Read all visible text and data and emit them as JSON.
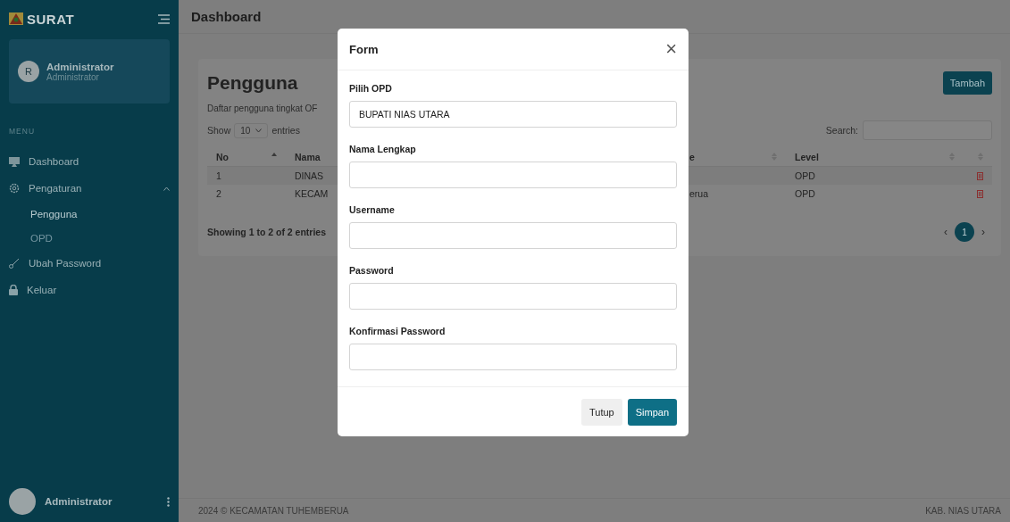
{
  "sidebar": {
    "brand": "SURAT",
    "profile": {
      "avatar": "R",
      "name": "Administrator",
      "role": "Administrator"
    },
    "menu_heading": "MENU",
    "items": [
      {
        "label": "Dashboard",
        "selected": false
      },
      {
        "label": "Pengaturan",
        "selected": false,
        "expanded": true,
        "children": [
          {
            "label": "Pengguna",
            "selected": true
          },
          {
            "label": "OPD",
            "selected": false
          }
        ]
      },
      {
        "label": "Ubah Password",
        "selected": false
      },
      {
        "label": "Keluar",
        "selected": false
      }
    ],
    "footer_user": {
      "name": "Administrator"
    }
  },
  "header": {
    "title": "Dashboard"
  },
  "card": {
    "title": "Pengguna",
    "subtitle": "Daftar pengguna tingkat OF",
    "add_button": "Tambah",
    "show_label": "Show",
    "page_size": "10",
    "entries_label": "entries",
    "search_label": "Search:",
    "columns": [
      {
        "label": "No",
        "sorted": true
      },
      {
        "label": "Nama"
      },
      {
        "label": "e",
        "sorted": false
      },
      {
        "label": "Level",
        "sorted": false
      },
      {
        "sorted": false
      }
    ],
    "rows": [
      {
        "no": "1",
        "name": "DINAS",
        "level": "OPD"
      },
      {
        "no": "2",
        "name": "KECAM",
        "column_3": "erua",
        "level": "OPD"
      }
    ],
    "info": "Showing 1 to 2 of 2 entries",
    "pagination": {
      "prev": "‹",
      "pages": [
        {
          "label": "1",
          "selected": true
        }
      ],
      "next": "›"
    }
  },
  "footer": {
    "left": "2024 © KECAMATAN TUHEMBERUA",
    "right": "KAB. NIAS UTARA"
  },
  "modal": {
    "title": "Form",
    "close": "×",
    "fields": [
      {
        "label": "Pilih OPD",
        "value": "BUPATI NIAS UTARA"
      },
      {
        "label": "Nama Lengkap"
      },
      {
        "label": "Username"
      },
      {
        "label": "Password"
      },
      {
        "label": "Konfirmasi Password"
      }
    ],
    "buttons": [
      {
        "label": "Tutup",
        "kind": "secondary"
      },
      {
        "label": "Simpan",
        "kind": "primary"
      }
    ]
  }
}
